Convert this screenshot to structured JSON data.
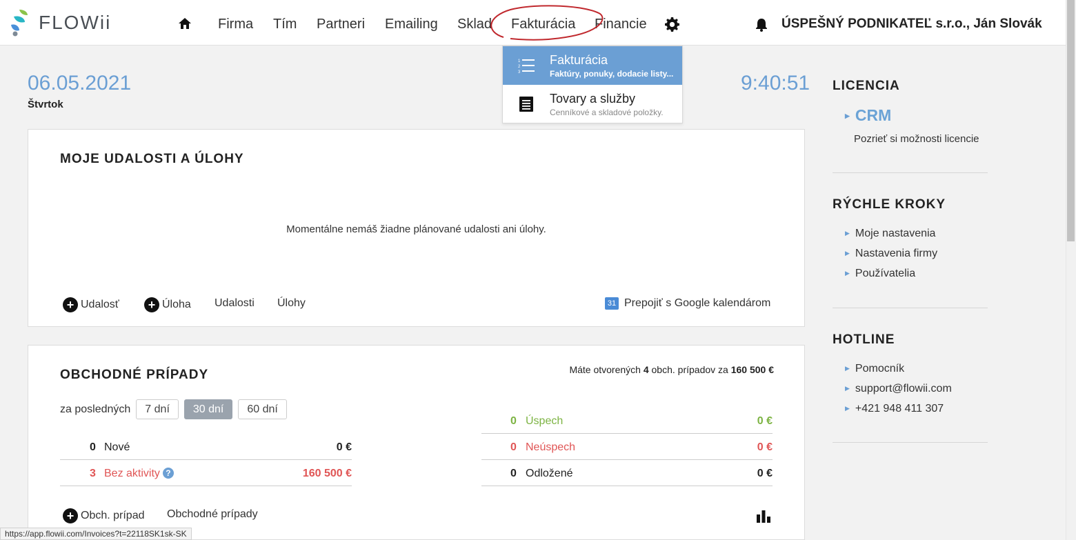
{
  "header": {
    "logo_text": "FLOWii",
    "nav": [
      "Firma",
      "Tím",
      "Partneri",
      "Emailing",
      "Sklad",
      "Fakturácia",
      "Financie"
    ],
    "company": "ÚSPEŠNÝ PODNIKATEĽ s.r.o., Ján Slovák"
  },
  "dropdown": {
    "items": [
      {
        "title": "Fakturácia",
        "subtitle": "Faktúry, ponuky, dodacie listy..."
      },
      {
        "title": "Tovary a služby",
        "subtitle": "Cenníkové a skladové položky."
      }
    ]
  },
  "dashboard": {
    "date": "06.05.2021",
    "weekday": "Štvrtok",
    "time": "9:40:51"
  },
  "events": {
    "title": "MOJE UDALOSTI A ÚLOHY",
    "empty": "Momentálne nemáš žiadne plánované udalosti ani úlohy.",
    "add_event": "Udalosť",
    "add_task": "Úloha",
    "events_link": "Udalosti",
    "tasks_link": "Úlohy",
    "gcal_badge": "31",
    "google": "Prepojiť s Google kalendárom"
  },
  "deals": {
    "title": "OBCHODNÉ PRÍPADY",
    "summary_pre": "Máte otvorených ",
    "summary_count": "4",
    "summary_mid": " obch. prípadov za ",
    "summary_amount": "160 500 €",
    "period_label": "za posledných",
    "periods": [
      "7 dní",
      "30 dní",
      "60 dní"
    ],
    "left_rows": [
      {
        "count": "0",
        "label": "Nové",
        "amount": "0 €"
      },
      {
        "count": "3",
        "label": "Bez aktivity",
        "amount": "160 500 €"
      }
    ],
    "right_rows": [
      {
        "count": "0",
        "label": "Úspech",
        "amount": "0 €"
      },
      {
        "count": "0",
        "label": "Neúspech",
        "amount": "0 €"
      },
      {
        "count": "0",
        "label": "Odložené",
        "amount": "0 €"
      }
    ],
    "add_deal": "Obch. prípad",
    "deals_link": "Obchodné prípady"
  },
  "sidebar": {
    "license_title": "LICENCIA",
    "crm": "CRM",
    "crm_link": "Pozrieť si možnosti licencie",
    "quick_title": "RÝCHLE KROKY",
    "quick_links": [
      "Moje nastavenia",
      "Nastavenia firmy",
      "Používatelia"
    ],
    "hotline_title": "HOTLINE",
    "hotline_links": [
      "Pomocník",
      "support@flowii.com",
      "+421 948 411 307"
    ]
  },
  "status_url": "https://app.flowii.com/Invoices?t=22118SK1sk-SK",
  "colors": {
    "accent": "#6b9fd4",
    "success": "#7cb342",
    "danger": "#e05555",
    "annotation": "#c0282d"
  }
}
